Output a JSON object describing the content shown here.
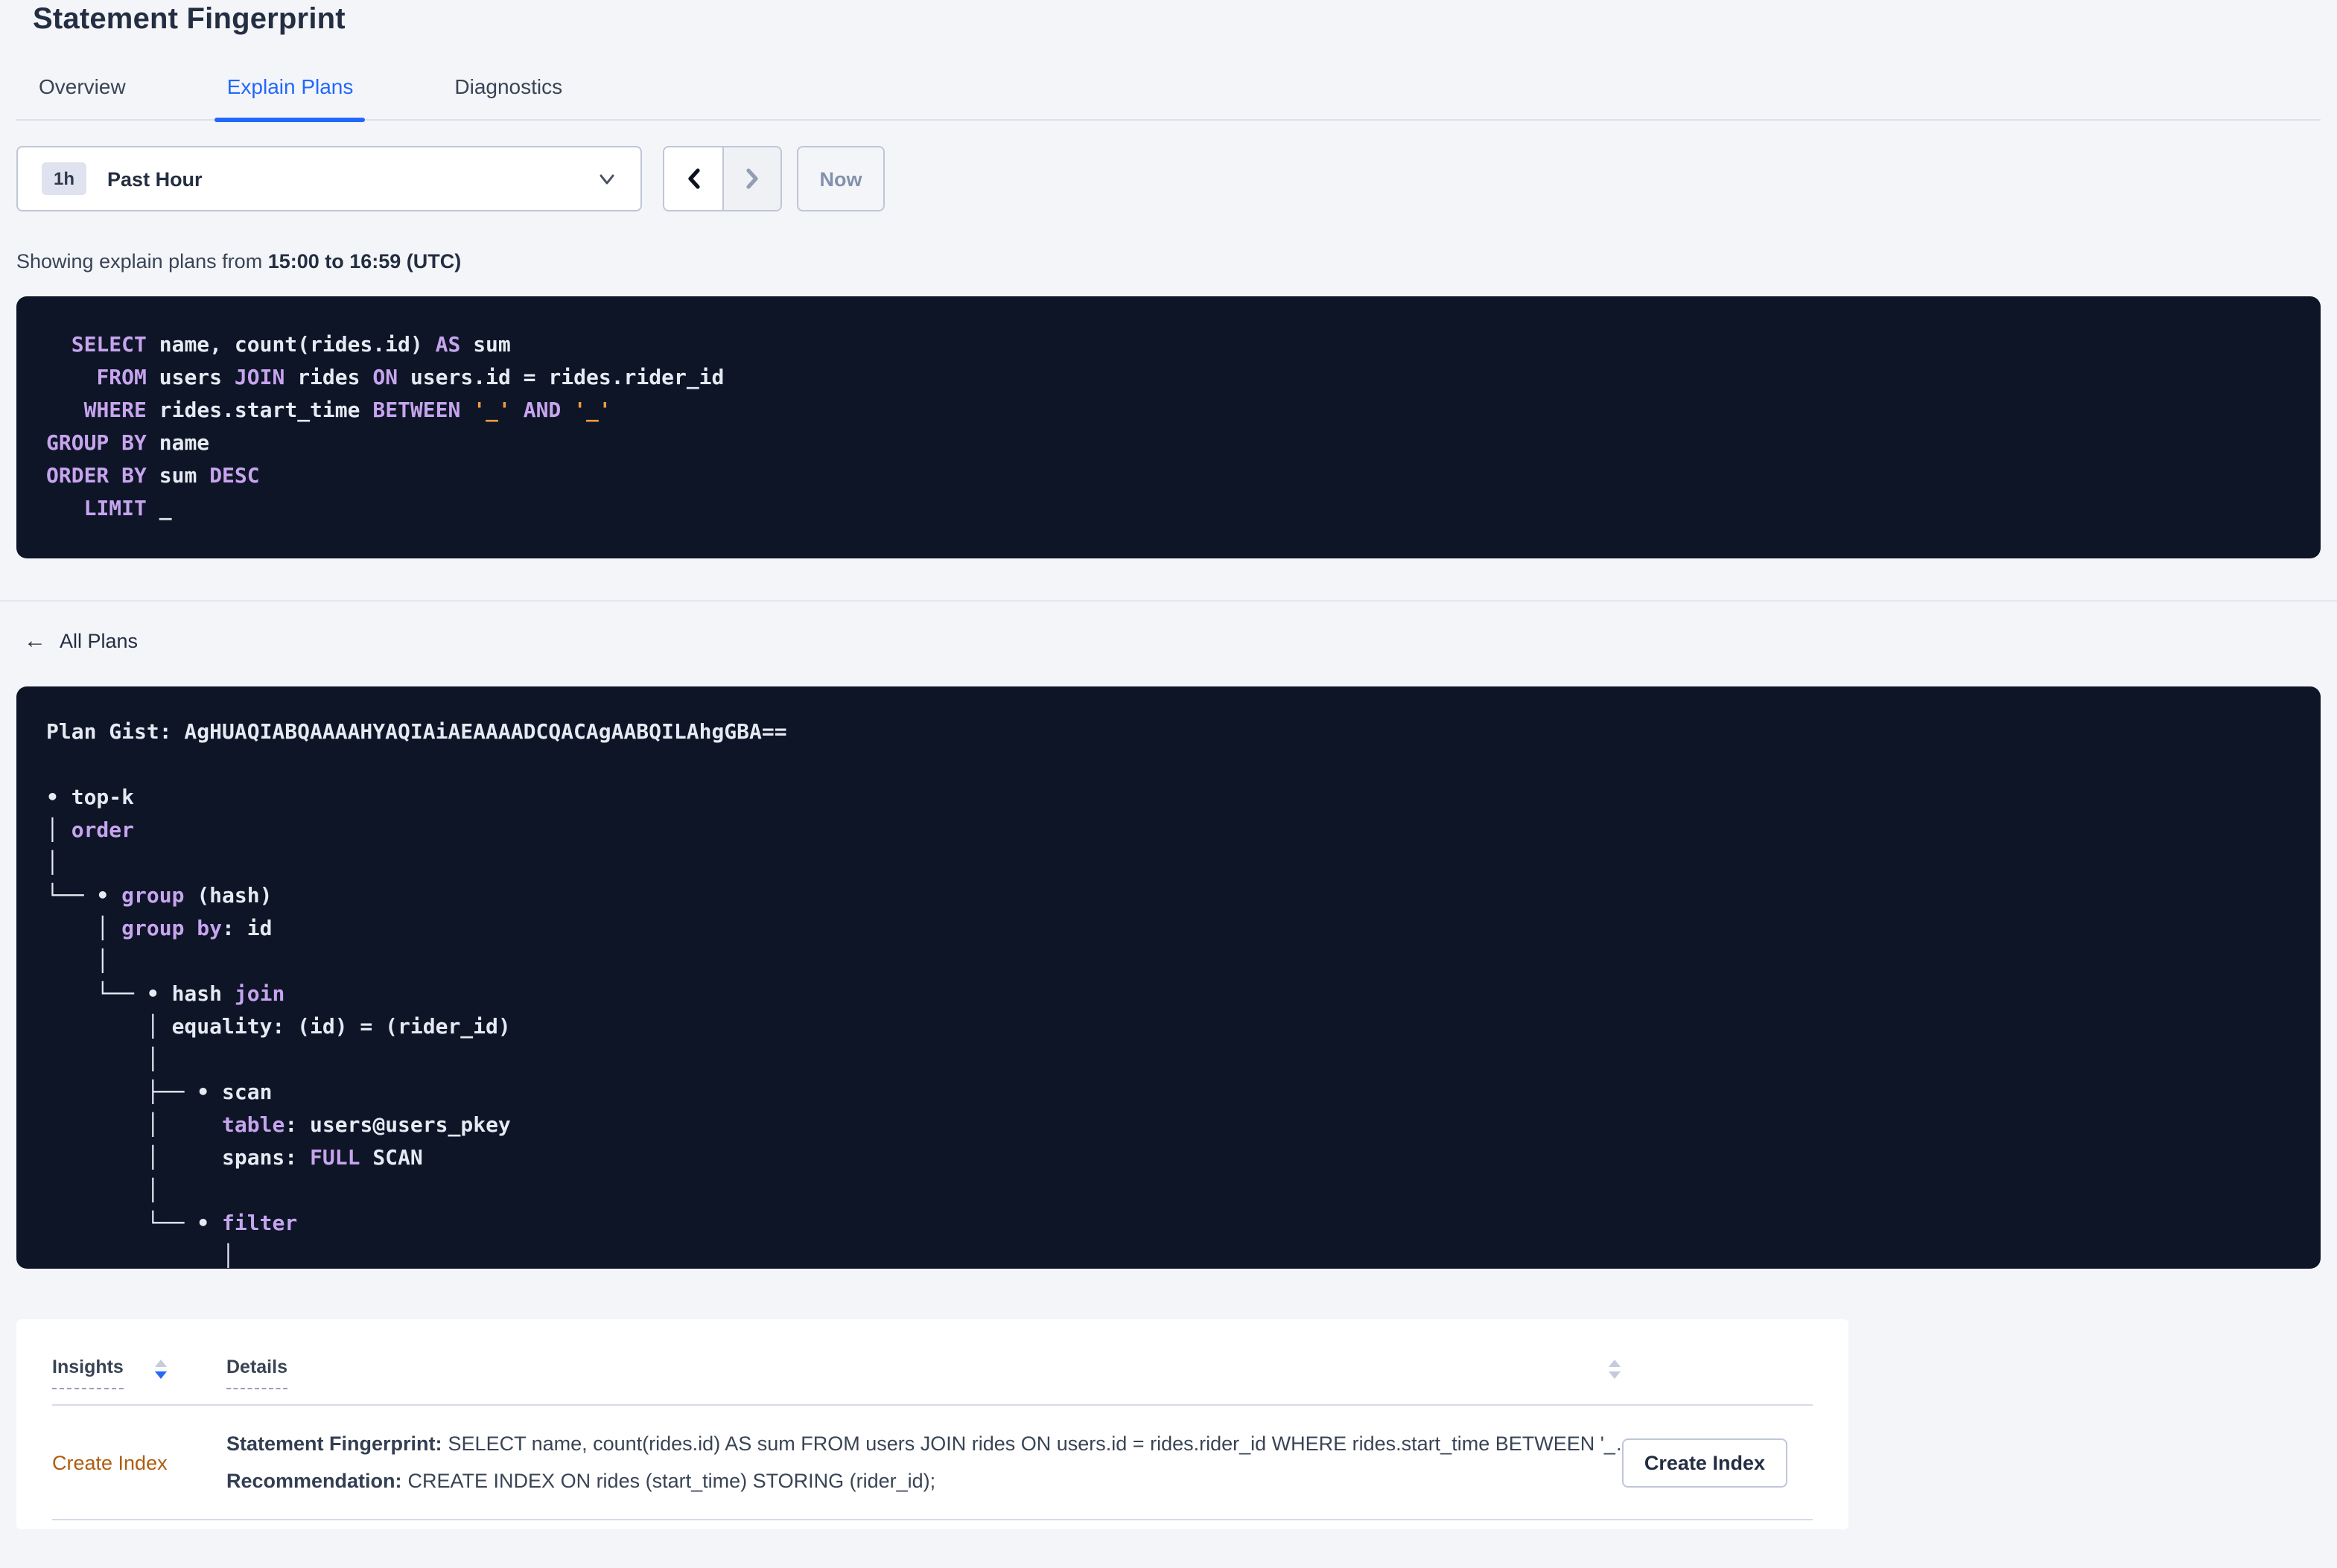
{
  "page": {
    "title": "Statement Fingerprint"
  },
  "tabs": [
    {
      "label": "Overview",
      "active": false
    },
    {
      "label": "Explain Plans",
      "active": true
    },
    {
      "label": "Diagnostics",
      "active": false
    }
  ],
  "time_selector": {
    "badge": "1h",
    "label": "Past Hour",
    "now_label": "Now",
    "icons": {
      "dropdown": "chevron-down-icon",
      "prev": "chevron-left-icon",
      "next": "chevron-right-icon"
    }
  },
  "summary": {
    "prefix": "Showing explain plans from ",
    "range": "15:00 to 16:59 (UTC)"
  },
  "sql": {
    "lines": [
      [
        [
          "p",
          "  "
        ],
        [
          "k",
          "SELECT"
        ],
        [
          "p",
          " name, count(rides.id) "
        ],
        [
          "k",
          "AS"
        ],
        [
          "p",
          " sum"
        ]
      ],
      [
        [
          "p",
          "    "
        ],
        [
          "k",
          "FROM"
        ],
        [
          "p",
          " users "
        ],
        [
          "k",
          "JOIN"
        ],
        [
          "p",
          " rides "
        ],
        [
          "k",
          "ON"
        ],
        [
          "p",
          " users.id = rides.rider_id"
        ]
      ],
      [
        [
          "p",
          "   "
        ],
        [
          "k",
          "WHERE"
        ],
        [
          "p",
          " rides.start_time "
        ],
        [
          "k",
          "BETWEEN"
        ],
        [
          "p",
          " "
        ],
        [
          "s",
          "'_'"
        ],
        [
          "p",
          " "
        ],
        [
          "k",
          "AND"
        ],
        [
          "p",
          " "
        ],
        [
          "s",
          "'_'"
        ]
      ],
      [
        [
          "k",
          "GROUP BY"
        ],
        [
          "p",
          " name"
        ]
      ],
      [
        [
          "k",
          "ORDER BY"
        ],
        [
          "p",
          " sum "
        ],
        [
          "k",
          "DESC"
        ]
      ],
      [
        [
          "p",
          "   "
        ],
        [
          "k",
          "LIMIT"
        ],
        [
          "p",
          " _"
        ]
      ]
    ]
  },
  "all_plans_label": "All Plans",
  "plan": {
    "gist": "AgHUAQIABQAAAAHYAQIAiAEAAAADCQACAgAABQILAhgGBA==",
    "lines": [
      [
        [
          "p",
          "Plan Gist: AgHUAQIABQAAAAHYAQIAiAEAAAADCQACAgAABQILAhgGBA=="
        ]
      ],
      [],
      [
        [
          "p",
          "• top-k"
        ]
      ],
      [
        [
          "p",
          "│ "
        ],
        [
          "k",
          "order"
        ]
      ],
      [
        [
          "p",
          "│"
        ]
      ],
      [
        [
          "p",
          "└── • "
        ],
        [
          "k",
          "group"
        ],
        [
          "p",
          " (hash)"
        ]
      ],
      [
        [
          "p",
          "    │ "
        ],
        [
          "k",
          "group by"
        ],
        [
          "p",
          ": id"
        ]
      ],
      [
        [
          "p",
          "    │"
        ]
      ],
      [
        [
          "p",
          "    └── • hash "
        ],
        [
          "k",
          "join"
        ]
      ],
      [
        [
          "p",
          "        │ equality: (id) = (rider_id)"
        ]
      ],
      [
        [
          "p",
          "        │"
        ]
      ],
      [
        [
          "p",
          "        ├── • scan"
        ]
      ],
      [
        [
          "p",
          "        │     "
        ],
        [
          "k",
          "table"
        ],
        [
          "p",
          ": users@users_pkey"
        ]
      ],
      [
        [
          "p",
          "        │     spans: "
        ],
        [
          "k",
          "FULL"
        ],
        [
          "p",
          " SCAN"
        ]
      ],
      [
        [
          "p",
          "        │"
        ]
      ],
      [
        [
          "p",
          "        └── • "
        ],
        [
          "k",
          "filter"
        ]
      ],
      [
        [
          "p",
          "              │"
        ]
      ]
    ]
  },
  "insights_table": {
    "headers": {
      "insights": "Insights",
      "details": "Details"
    },
    "rows": [
      {
        "insight": "Create Index",
        "details": [
          {
            "label": "Statement Fingerprint:",
            "text": "SELECT name, count(rides.id) AS sum FROM users JOIN rides ON users.id = rides.rider_id WHERE rides.start_time BETWEEN '_…"
          },
          {
            "label": "Recommendation:",
            "text": "CREATE INDEX ON rides (start_time) STORING (rider_id);"
          }
        ],
        "action_label": "Create Index"
      }
    ]
  },
  "colors": {
    "accent_blue": "#2268fb",
    "keyword_purple": "#c7a4ee",
    "string_orange": "#ee9b3e",
    "insight_link_orange": "#b05c10",
    "code_background": "#0d1527",
    "page_background": "#f4f5f9"
  }
}
